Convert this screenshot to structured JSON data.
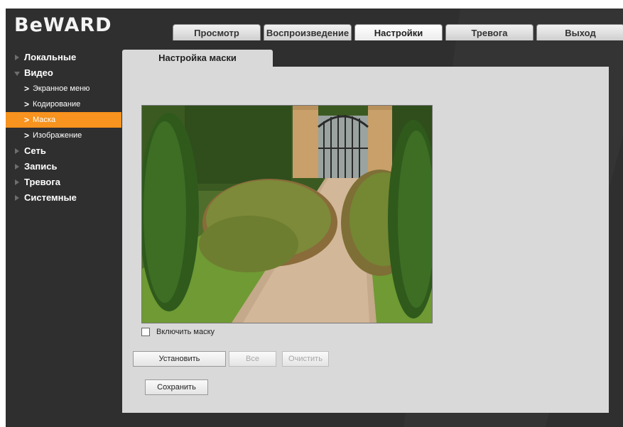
{
  "logo": {
    "text": "BeWARD"
  },
  "nav": {
    "tabs": [
      {
        "label": "Просмотр"
      },
      {
        "label": "Воспроизведение"
      },
      {
        "label": "Настройки"
      },
      {
        "label": "Тревога"
      },
      {
        "label": "Выход"
      }
    ],
    "active": "Настройки"
  },
  "sidebar": {
    "items": [
      {
        "label": "Локальные"
      },
      {
        "label": "Видео"
      },
      {
        "label": "Экранное меню"
      },
      {
        "label": "Кодирование"
      },
      {
        "label": "Маска"
      },
      {
        "label": "Изображение"
      },
      {
        "label": "Сеть"
      },
      {
        "label": "Запись"
      },
      {
        "label": "Тревога"
      },
      {
        "label": "Системные"
      }
    ],
    "active": "Маска"
  },
  "content": {
    "tab_title": "Настройка маски",
    "enable_mask_label": "Включить маску",
    "enable_mask_checked": false,
    "buttons": {
      "set": "Установить",
      "all": "Все",
      "clear": "Очистить",
      "save": "Сохранить"
    }
  },
  "colors": {
    "accent": "#f7931e",
    "panel": "#d9d9d9",
    "frame": "#2f2f2f"
  },
  "icons": {
    "collapsed": "triangle-right-icon",
    "expanded": "triangle-down-icon",
    "sub": "chevron-right-icon"
  }
}
